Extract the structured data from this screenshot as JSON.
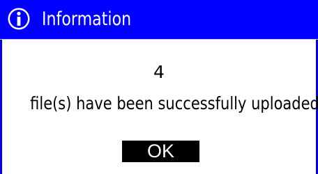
{
  "dialog": {
    "title": "Information",
    "icon": "info-icon",
    "count": "4",
    "message": "file(s) have been successfully uploaded.",
    "ok_label": "OK"
  },
  "colors": {
    "title_bar": "#0000ff",
    "border": "#0000ee",
    "button_bg": "#000000",
    "button_text": "#ffffff"
  }
}
